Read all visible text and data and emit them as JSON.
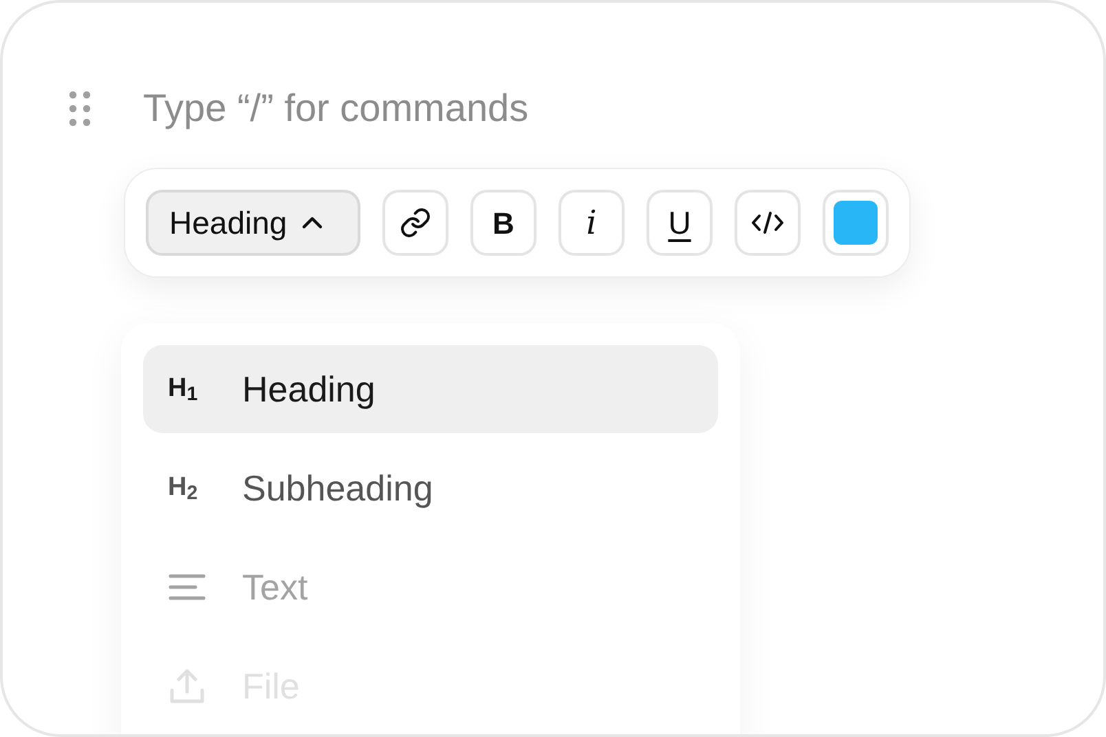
{
  "editor": {
    "placeholder": "Type “/” for commands"
  },
  "toolbar": {
    "block_type": {
      "label": "Heading",
      "expanded": true
    },
    "buttons": [
      {
        "kind": "link"
      },
      {
        "kind": "bold",
        "label": "B"
      },
      {
        "kind": "italic",
        "label": "i"
      },
      {
        "kind": "underline",
        "label": "U"
      },
      {
        "kind": "code"
      },
      {
        "kind": "color",
        "color": "#29b6f6"
      }
    ]
  },
  "menu": {
    "items": [
      {
        "kind": "h1",
        "icon": "H$_{1}$",
        "label": "Heading",
        "selected": true
      },
      {
        "kind": "h2",
        "icon": "H$_{2}$",
        "label": "Subheading",
        "selected": false
      },
      {
        "kind": "text",
        "label": "Text",
        "selected": false
      },
      {
        "kind": "file",
        "label": "File",
        "selected": false
      }
    ]
  }
}
